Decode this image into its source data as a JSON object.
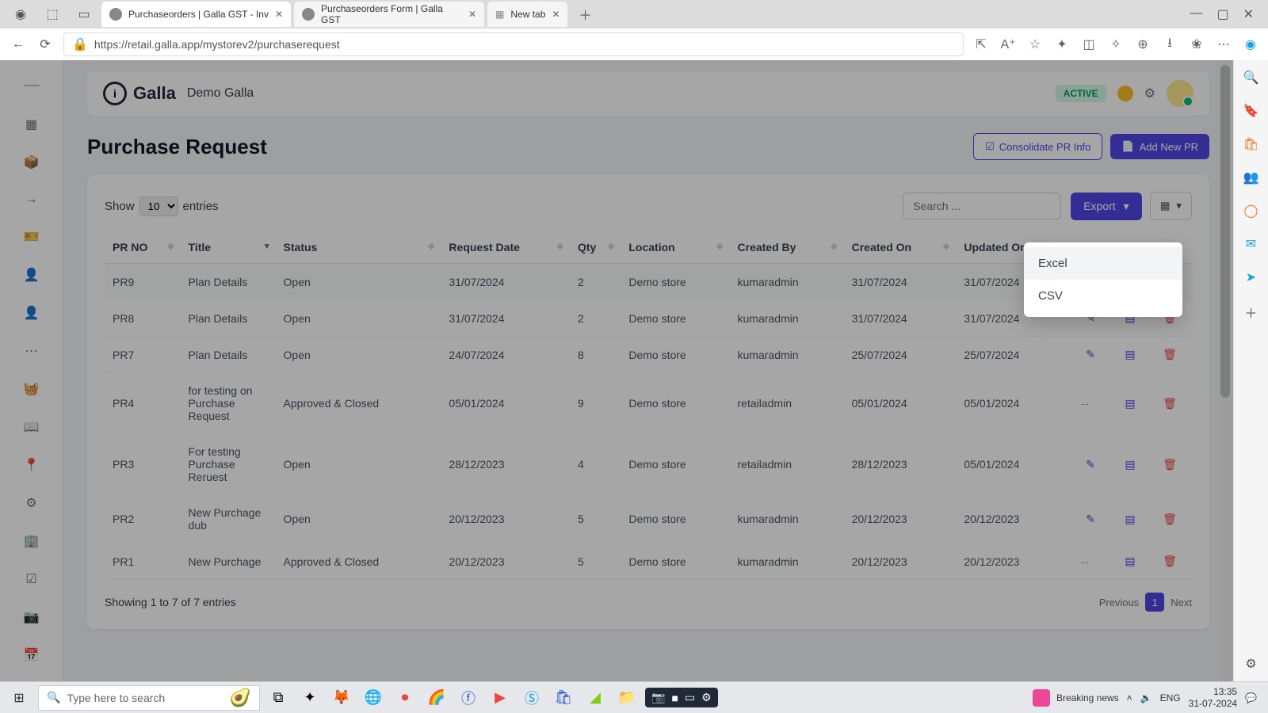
{
  "browser": {
    "tabs": [
      {
        "title": "Purchaseorders | Galla GST - Inv"
      },
      {
        "title": "Purchaseorders Form | Galla GST"
      },
      {
        "title": "New tab"
      }
    ],
    "url": "https://retail.galla.app/mystorev2/purchaserequest"
  },
  "header": {
    "brand": "Galla",
    "store": "Demo Galla",
    "status": "ACTIVE"
  },
  "page": {
    "title": "Purchase Request",
    "btn_consolidate": "Consolidate PR Info",
    "btn_add": "Add New PR"
  },
  "table_controls": {
    "show_label": "Show",
    "show_value": "10",
    "entries_label": "entries",
    "search_placeholder": "Search ...",
    "export_label": "Export"
  },
  "export_menu": {
    "excel": "Excel",
    "csv": "CSV"
  },
  "columns": {
    "prno": "PR NO",
    "title": "Title",
    "status": "Status",
    "reqdate": "Request Date",
    "qty": "Qty",
    "location": "Location",
    "createdby": "Created By",
    "createdon": "Created On",
    "updatedon": "Updated On"
  },
  "rows": [
    {
      "prno": "PR9",
      "title": "Plan Details",
      "status": "Open",
      "reqdate": "31/07/2024",
      "qty": "2",
      "location": "Demo store",
      "createdby": "kumaradmin",
      "createdon": "31/07/2024",
      "updatedon": "31/07/2024",
      "edit": true
    },
    {
      "prno": "PR8",
      "title": "Plan Details",
      "status": "Open",
      "reqdate": "31/07/2024",
      "qty": "2",
      "location": "Demo store",
      "createdby": "kumaradmin",
      "createdon": "31/07/2024",
      "updatedon": "31/07/2024",
      "edit": true
    },
    {
      "prno": "PR7",
      "title": "Plan Details",
      "status": "Open",
      "reqdate": "24/07/2024",
      "qty": "8",
      "location": "Demo store",
      "createdby": "kumaradmin",
      "createdon": "25/07/2024",
      "updatedon": "25/07/2024",
      "edit": true
    },
    {
      "prno": "PR4",
      "title": "for testing on Purchase Request",
      "status": "Approved & Closed",
      "reqdate": "05/01/2024",
      "qty": "9",
      "location": "Demo store",
      "createdby": "retailadmin",
      "createdon": "05/01/2024",
      "updatedon": "05/01/2024",
      "edit": false
    },
    {
      "prno": "PR3",
      "title": "For testing Purchase Reruest",
      "status": "Open",
      "reqdate": "28/12/2023",
      "qty": "4",
      "location": "Demo store",
      "createdby": "retailadmin",
      "createdon": "28/12/2023",
      "updatedon": "05/01/2024",
      "edit": true
    },
    {
      "prno": "PR2",
      "title": "New Purchage dub",
      "status": "Open",
      "reqdate": "20/12/2023",
      "qty": "5",
      "location": "Demo store",
      "createdby": "kumaradmin",
      "createdon": "20/12/2023",
      "updatedon": "20/12/2023",
      "edit": true
    },
    {
      "prno": "PR1",
      "title": "New Purchage",
      "status": "Approved & Closed",
      "reqdate": "20/12/2023",
      "qty": "5",
      "location": "Demo store",
      "createdby": "kumaradmin",
      "createdon": "20/12/2023",
      "updatedon": "20/12/2023",
      "edit": false
    }
  ],
  "footer": {
    "info": "Showing 1 to 7 of 7 entries",
    "prev": "Previous",
    "page": "1",
    "next": "Next"
  },
  "taskbar": {
    "search_placeholder": "Type here to search",
    "news": "Breaking news",
    "lang": "ENG",
    "time": "13:35",
    "date": "31-07-2024"
  }
}
